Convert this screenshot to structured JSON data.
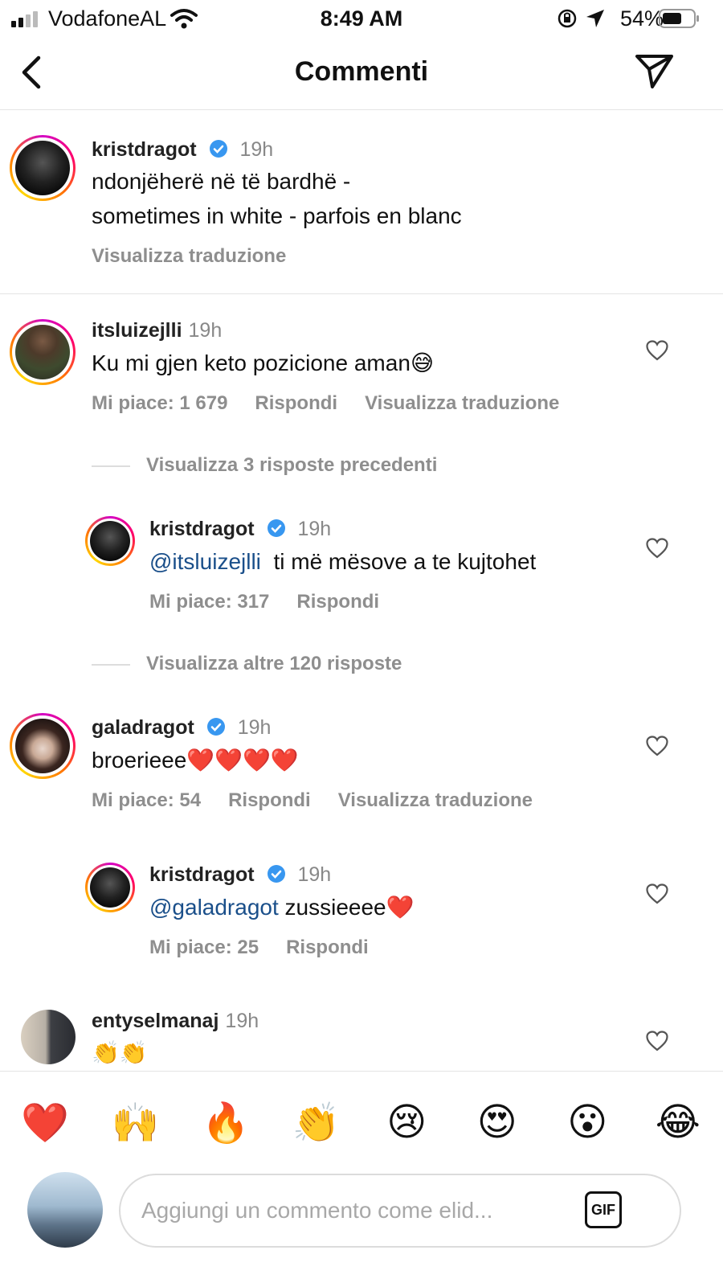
{
  "status_bar": {
    "carrier": "VodafoneAL",
    "time": "8:49 AM",
    "battery": "54%"
  },
  "header": {
    "title": "Commenti"
  },
  "caption": {
    "username": "kristdragot",
    "time": "19h",
    "text_line1": "ndonjëherë në të bardhë -",
    "text_line2": "sometimes in white - parfois en blanc",
    "translate": "Visualizza traduzione"
  },
  "comments": [
    {
      "username": "itsluizejlli",
      "time": "19h",
      "text": "Ku mi gjen keto pozicione aman😅",
      "likes": "Mi piace: 1 679",
      "reply": "Rispondi",
      "translate": "Visualizza traduzione"
    },
    {
      "username": "kristdragot",
      "time": "19h",
      "mention": "@itsluizejlli",
      "text": "  ti më mësove a te kujtohet",
      "likes": "Mi piace: 317",
      "reply": "Rispondi"
    },
    {
      "username": "galadragot",
      "time": "19h",
      "text": "broerieee❤️❤️❤️❤️",
      "likes": "Mi piace: 54",
      "reply": "Rispondi",
      "translate": "Visualizza traduzione"
    },
    {
      "username": "kristdragot",
      "time": "19h",
      "mention": "@galadragot",
      "text": " zussieeee❤️",
      "likes": "Mi piace: 25",
      "reply": "Rispondi"
    },
    {
      "username": "entyselmanaj",
      "time": "19h",
      "text": "👏👏"
    }
  ],
  "view_previous": "Visualizza 3 risposte precedenti",
  "view_more": "Visualizza altre 120 risposte",
  "quick_emojis": [
    "❤️",
    "🙌",
    "🔥",
    "👏",
    "😢",
    "😍",
    "😮",
    "😂"
  ],
  "composer": {
    "placeholder": "Aggiungi un commento come elid...",
    "gif_label": "GIF"
  },
  "colors": {
    "mention": "#1a4f8a",
    "verified": "#3897f0",
    "muted": "#8e8e8e"
  }
}
